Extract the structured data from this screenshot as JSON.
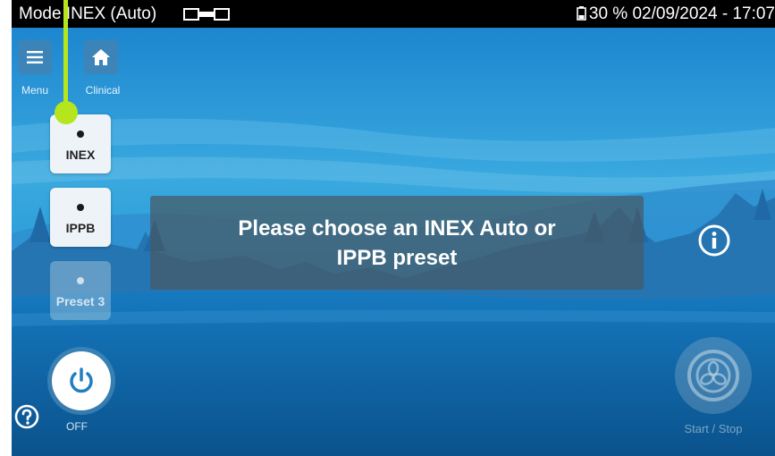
{
  "statusbar": {
    "mode_text": "Mode INEX (Auto)",
    "battery_text": "30 %",
    "datetime_text": "02/09/2024 - 17:07"
  },
  "nav": {
    "menu_label": "Menu",
    "clinical_label": "Clinical"
  },
  "presets": [
    {
      "label": "INEX",
      "enabled": true
    },
    {
      "label": "IPPB",
      "enabled": true
    },
    {
      "label": "Preset 3",
      "enabled": false
    }
  ],
  "message": {
    "line1": "Please choose an INEX Auto or",
    "line2": "IPPB preset"
  },
  "power": {
    "label": "OFF"
  },
  "start_stop": {
    "label": "Start / Stop"
  },
  "icons": {
    "menu": "hamburger-icon",
    "home": "home-icon",
    "help": "question-icon",
    "info": "info-icon",
    "power": "power-icon",
    "fan": "fan-icon",
    "battery": "battery-icon",
    "mode": "mode-indicator-icon"
  },
  "colors": {
    "accent_pointer": "#b5e61d",
    "statusbar_bg": "#000000",
    "sky_top": "#1a8fd6"
  }
}
